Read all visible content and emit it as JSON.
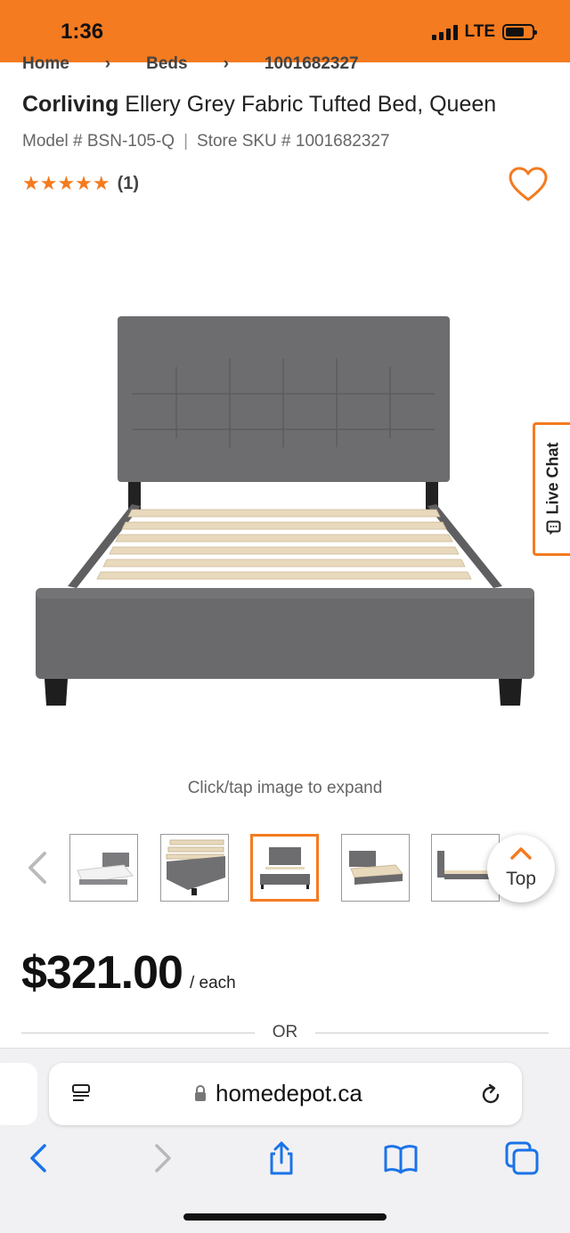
{
  "status_bar": {
    "time": "1:36",
    "network": "LTE"
  },
  "breadcrumb": {
    "items": [
      "Home",
      "Beds",
      "1001682327"
    ]
  },
  "product": {
    "brand": "Corliving",
    "name": "Ellery Grey Fabric Tufted Bed, Queen",
    "model_label": "Model # BSN-105-Q",
    "sku_label": "Store SKU # 1001682327",
    "rating_stars": "★★★★★",
    "rating_value": 5,
    "rating_count": "(1)",
    "expand_hint": "Click/tap image to expand",
    "price": "$321.00",
    "price_unit": "/ each",
    "or_label": "OR"
  },
  "live_chat": {
    "label": "Live Chat"
  },
  "top_button": {
    "label": "Top"
  },
  "thumbnails": {
    "count": 5,
    "active_index": 2
  },
  "browser": {
    "url": "homedepot.ca"
  },
  "colors": {
    "brand": "#f47b20",
    "bed_fabric": "#6d6d70",
    "slats": "#e8d9bd",
    "link_blue": "#1a73e8"
  },
  "icons": [
    "heart-icon",
    "chat-icon",
    "chevron-left-icon",
    "chevron-up-icon",
    "lock-icon",
    "reload-icon",
    "reader-icon",
    "back-icon",
    "forward-icon",
    "share-icon",
    "bookmarks-icon",
    "tabs-icon"
  ]
}
